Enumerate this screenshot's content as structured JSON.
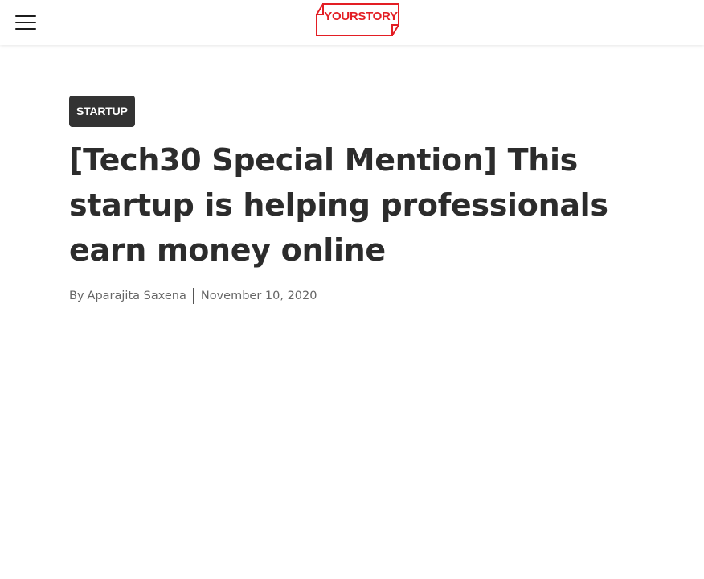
{
  "header": {
    "menu_icon": "hamburger-menu-icon",
    "logo_text": "YOURSTORY",
    "brand_color": "#e31e24"
  },
  "article": {
    "category": "STARTUP",
    "title": "[Tech30 Special Mention] This startup is helping professionals earn money online",
    "byline_prefix": "By",
    "author": "Aparajita Saxena",
    "date": "November 10, 2020"
  }
}
